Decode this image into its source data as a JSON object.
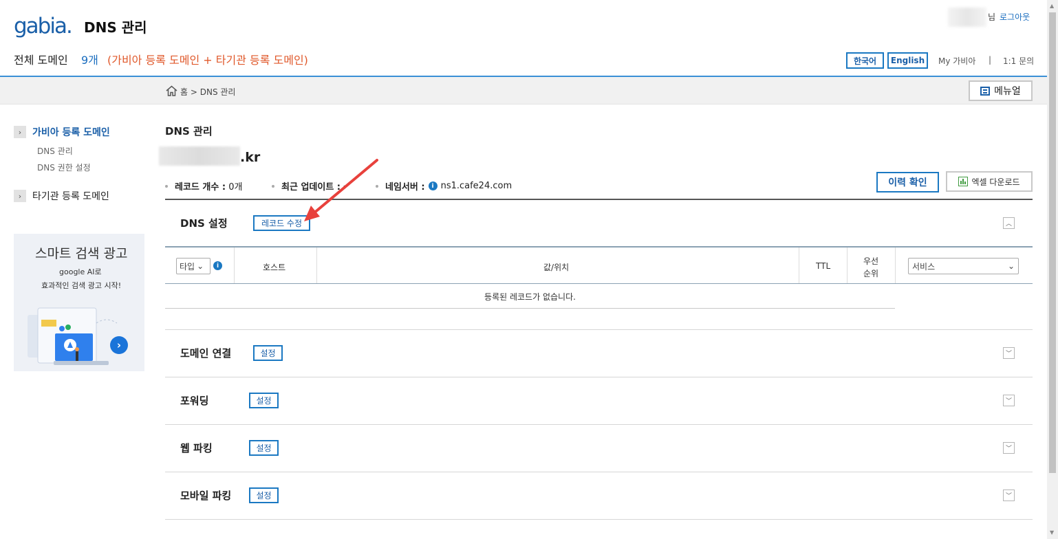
{
  "header": {
    "logo": "gabia",
    "logo_dot": ".",
    "title": "DNS 관리",
    "user_suffix": "님",
    "logout": "로그아웃",
    "domain_count_label": "전체 도메인",
    "domain_count": "9개",
    "domain_count_desc": "(가비아 등록 도메인 + 타기관 등록 도메인)",
    "lang_ko": "한국어",
    "lang_en": "English",
    "my_gabia": "My 가비아",
    "separator": "|",
    "inquiry": "1:1 문의"
  },
  "breadcrumb": {
    "text": "홈 > DNS 관리",
    "menu_label": "메뉴얼"
  },
  "sidebar": {
    "group1": "가비아 등록 도메인",
    "group1_items": [
      "DNS 관리",
      "DNS 권한 설정"
    ],
    "group2": "타기관 등록 도메인",
    "ad": {
      "title": "스마트 검색 광고",
      "line1": "google AI로",
      "line2": "효과적인 검색 광고 시작!"
    }
  },
  "main": {
    "title": "DNS 관리",
    "domain_suffix": ".kr",
    "record_count_label": "레코드 개수 :",
    "record_count": "0개",
    "last_update_label": "최근 업데이트 :",
    "last_update_value": "-",
    "nameserver_label": "네임서버 :",
    "nameserver": "ns1.cafe24.com",
    "history_btn": "이력 확인",
    "excel_btn": "엑셀 다운로드",
    "dns_section": {
      "title": "DNS 설정",
      "edit_btn": "레코드 수정",
      "columns": {
        "type": "타입",
        "host": "호스트",
        "value": "값/위치",
        "ttl": "TTL",
        "priority_line1": "우선",
        "priority_line2": "순위",
        "service": "서비스"
      },
      "empty": "등록된 레코드가 없습니다."
    },
    "sections": [
      {
        "title": "도메인 연결",
        "btn": "설정"
      },
      {
        "title": "포워딩",
        "btn": "설정"
      },
      {
        "title": "웹 파킹",
        "btn": "설정"
      },
      {
        "title": "모바일 파킹",
        "btn": "설정"
      }
    ]
  },
  "colors": {
    "accent": "#1a78c2",
    "orange": "#e0582a",
    "arrow": "#e8413c"
  }
}
